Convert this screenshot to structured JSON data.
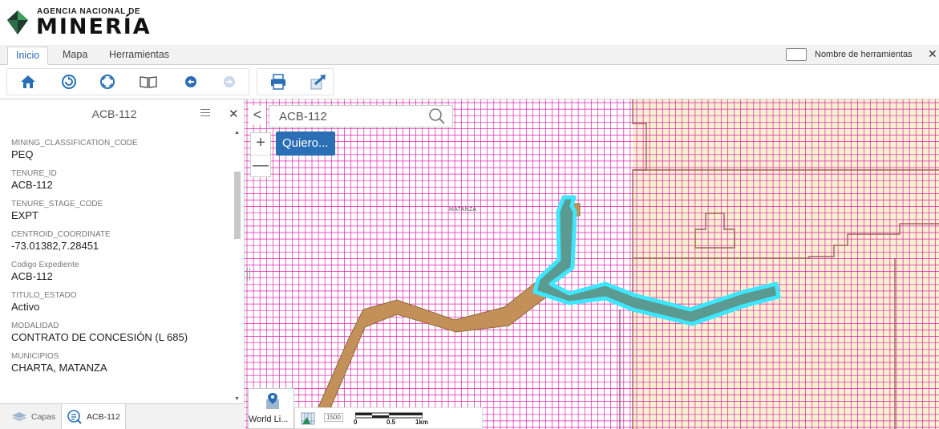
{
  "header": {
    "org_small": "AGENCIA NACIONAL DE",
    "org_big": "MINERÍA"
  },
  "tabs": [
    {
      "label": "Inicio",
      "active": true
    },
    {
      "label": "Mapa",
      "active": false
    },
    {
      "label": "Herramientas",
      "active": false
    }
  ],
  "tool_names_toggle": {
    "label": "Nombre de herramientas",
    "checked": false
  },
  "toolbar": {
    "buttons": [
      "home-icon",
      "refresh-icon",
      "full-extent-icon",
      "bookmark-icon",
      "back-icon",
      "forward-icon",
      "print-icon",
      "share-icon"
    ]
  },
  "panel": {
    "title": "ACB-112",
    "attributes": [
      {
        "label": "MINING_CLASSIFICATION_CODE",
        "value": "PEQ"
      },
      {
        "label": "TENURE_ID",
        "value": "ACB-112"
      },
      {
        "label": "TENURE_STAGE_CODE",
        "value": "EXPT"
      },
      {
        "label": "CENTROID_COORDINATE",
        "value": "-73.01382,7.28451"
      },
      {
        "label": "Codigo Expediente",
        "value": "ACB-112"
      },
      {
        "label": "TITULO_ESTADO",
        "value": "Activo"
      },
      {
        "label": "MODALIDAD",
        "value": "CONTRATO DE CONCESIÓN (L 685)"
      },
      {
        "label": "MUNICIPIOS",
        "value": "CHARTA, MATANZA"
      }
    ],
    "footer_tabs": [
      {
        "label": "Capas",
        "active": false
      },
      {
        "label": "ACB-112",
        "active": true
      }
    ]
  },
  "map": {
    "search_value": "ACB-112",
    "quiero_label": "Quiero...",
    "place_label": "MATANZA",
    "basemap_label": "World Li...",
    "scale_badge": "1500",
    "scale_labels": [
      "0",
      "0.5",
      "1km"
    ],
    "colors": {
      "grid": "#e020b0",
      "zone_fill": "#f7f1cf",
      "zone_line": "#a06060",
      "parcel_fill": "#c3905a",
      "highlight": "#3ee6ff",
      "highlight_fill": "#5a9a90",
      "accent": "#2a6fb5"
    }
  }
}
